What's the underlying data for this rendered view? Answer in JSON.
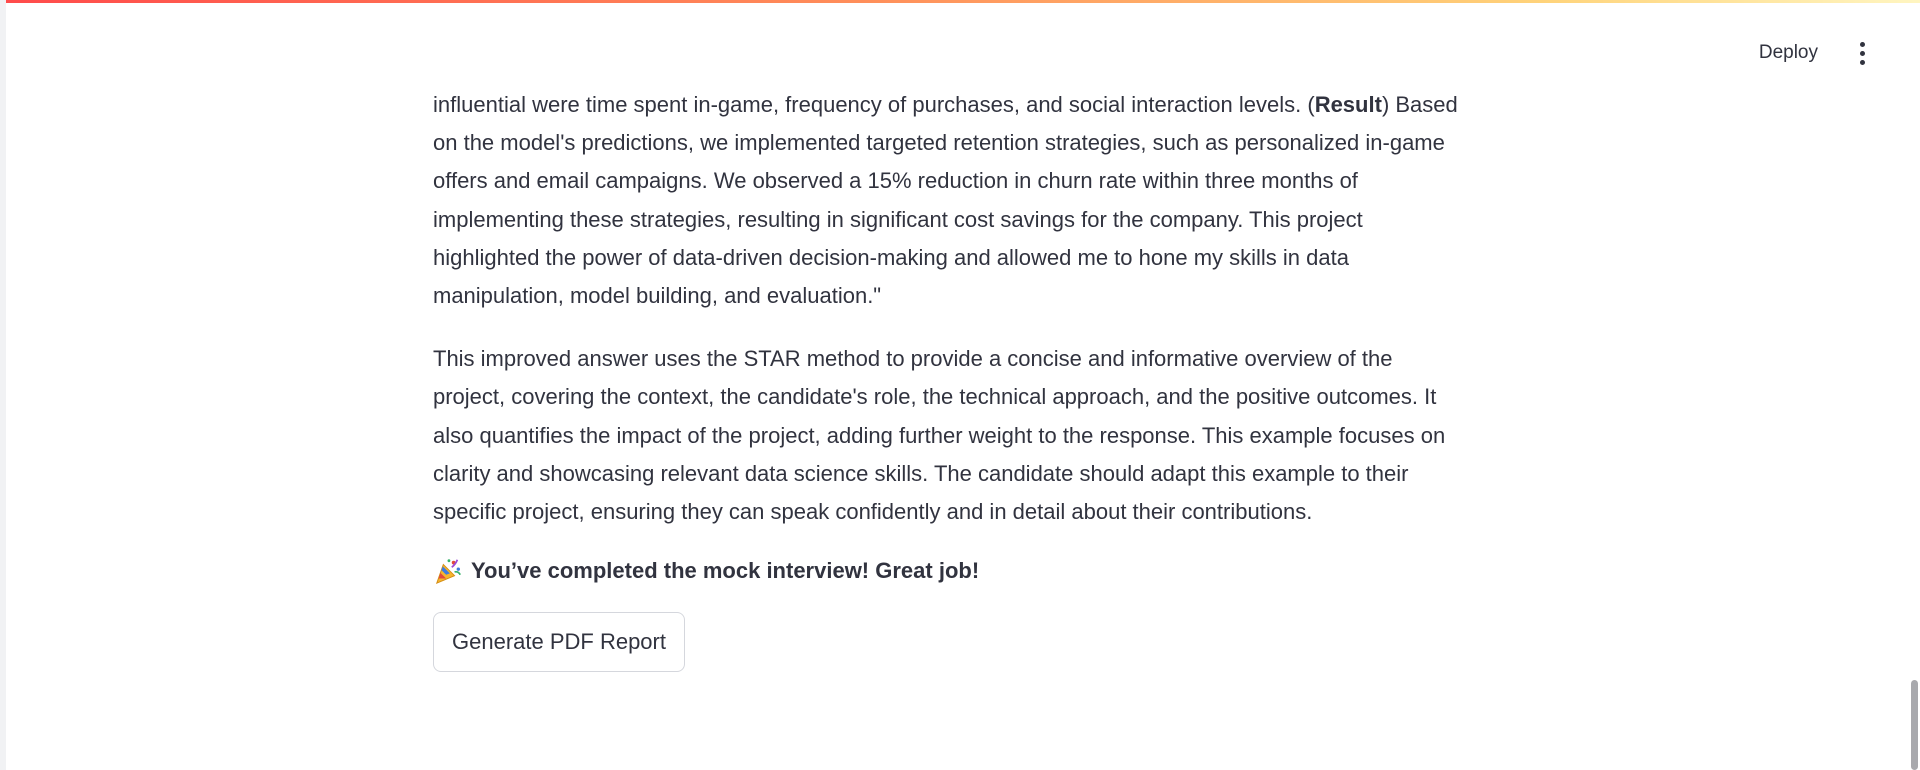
{
  "toolbar": {
    "deploy_label": "Deploy",
    "menu_icon": "vertical-ellipsis-icon"
  },
  "content": {
    "paragraph1_lines": [
      "influential were time spent in-game, frequency of purchases, and social interaction levels. (",
      "Result",
      ") Based",
      "on the model's predictions, we implemented targeted retention strategies, such as personalized in-game",
      "offers and email campaigns. We observed a 15% reduction in churn rate within three months of",
      "implementing these strategies, resulting in significant cost savings for the company. This project",
      "highlighted the power of data-driven decision-making and allowed me to hone my skills in data",
      "manipulation, model building, and evaluation.\""
    ],
    "paragraph2_lines": [
      "This improved answer uses the STAR method to provide a concise and informative overview of the",
      "project, covering the context, the candidate's role, the technical approach, and the positive outcomes. It",
      "also quantifies the impact of the project, adding further weight to the response. This example focuses on",
      "clarity and showcasing relevant data science skills. The candidate should adapt this example to their",
      "specific project, ensuring they can speak confidently and in detail about their contributions."
    ],
    "congrats_icon": "party-popper-icon",
    "congrats_text": "You’ve completed the mock interview! Great job!",
    "pdf_button_label": "Generate PDF Report"
  },
  "colors": {
    "text": "#31333f",
    "accent_gradient_start": "#ff4b4b",
    "accent_gradient_end": "#fff6c2",
    "button_border": "#d5d7dd"
  }
}
